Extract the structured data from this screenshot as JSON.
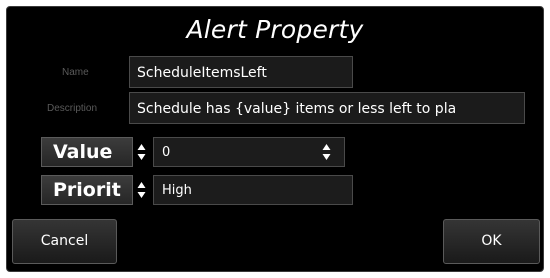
{
  "dialog": {
    "title": "Alert Property"
  },
  "fields": {
    "name_label": "Name",
    "name_value": "ScheduleItemsLeft",
    "description_label": "Description",
    "description_value": "Schedule has {value} items or less left to pla"
  },
  "value_row": {
    "label": "Value",
    "value": "0"
  },
  "priority_row": {
    "label": "Priorit",
    "value": "High"
  },
  "buttons": {
    "cancel": "Cancel",
    "ok": "OK"
  }
}
